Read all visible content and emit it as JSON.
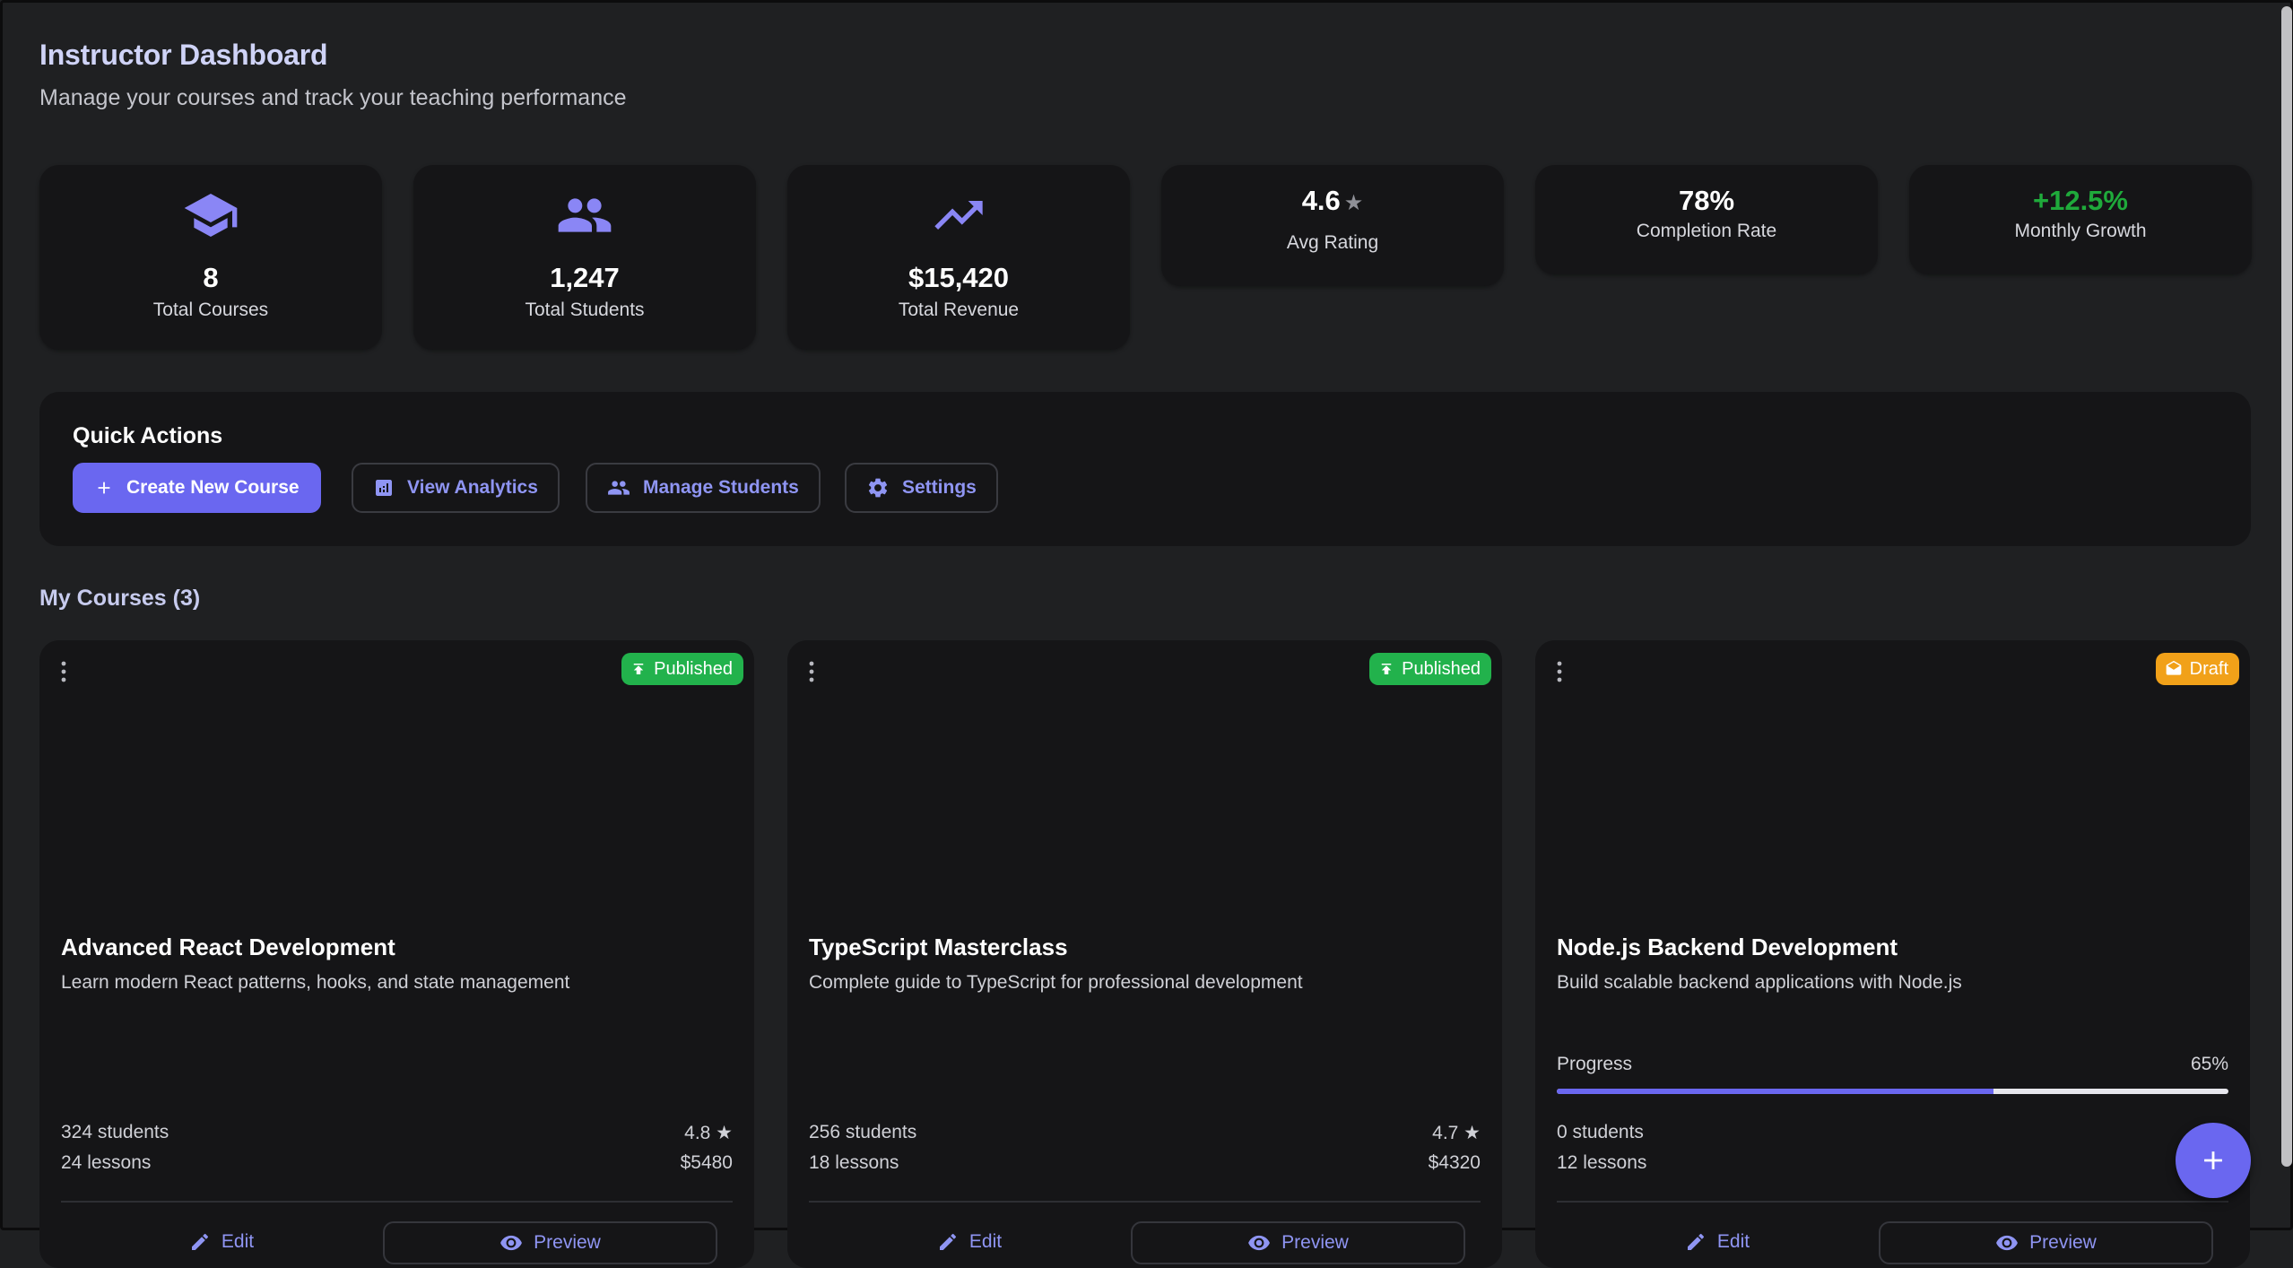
{
  "header": {
    "title": "Instructor Dashboard",
    "subtitle": "Manage your courses and track your teaching performance"
  },
  "stats": [
    {
      "icon": "graduation-cap-icon",
      "value": "8",
      "label": "Total Courses"
    },
    {
      "icon": "people-icon",
      "value": "1,247",
      "label": "Total Students"
    },
    {
      "icon": "trending-up-icon",
      "value": "$15,420",
      "label": "Total Revenue"
    },
    {
      "icon": "star-icon",
      "value": "4.6",
      "value_suffix": "★",
      "label": "Avg Rating"
    },
    {
      "value": "78%",
      "label": "Completion Rate"
    },
    {
      "value": "+12.5%",
      "label": "Monthly Growth",
      "color": "#1faa3b"
    }
  ],
  "quick_actions": {
    "title": "Quick Actions",
    "buttons": [
      {
        "label": "Create New Course",
        "icon": "plus-icon"
      },
      {
        "label": "View Analytics",
        "icon": "analytics-icon"
      },
      {
        "label": "Manage Students",
        "icon": "people-icon"
      },
      {
        "label": "Settings",
        "icon": "gear-icon"
      }
    ]
  },
  "courses_section": {
    "title": "My Courses (3)"
  },
  "courses": [
    {
      "status": "Published",
      "title": "Advanced React Development",
      "description": "Learn modern React patterns, hooks, and state management",
      "students": "324 students",
      "lessons": "24 lessons",
      "rating": "4.8 ★",
      "revenue": "$5480",
      "edit_label": "Edit",
      "preview_label": "Preview"
    },
    {
      "status": "Published",
      "title": "TypeScript Masterclass",
      "description": "Complete guide to TypeScript for professional development",
      "students": "256 students",
      "lessons": "18 lessons",
      "rating": "4.7 ★",
      "revenue": "$4320",
      "edit_label": "Edit",
      "preview_label": "Preview"
    },
    {
      "status": "Draft",
      "title": "Node.js Backend Development",
      "description": "Build scalable backend applications with Node.js",
      "progress_label": "Progress",
      "progress_value": "65%",
      "progress_fraction": 0.65,
      "students": "0 students",
      "lessons": "12 lessons",
      "edit_label": "Edit",
      "preview_label": "Preview"
    }
  ],
  "colors": {
    "accent": "#6a67f0",
    "published": "#22b24c",
    "draft": "#f1a119",
    "growth": "#1faa3b"
  }
}
